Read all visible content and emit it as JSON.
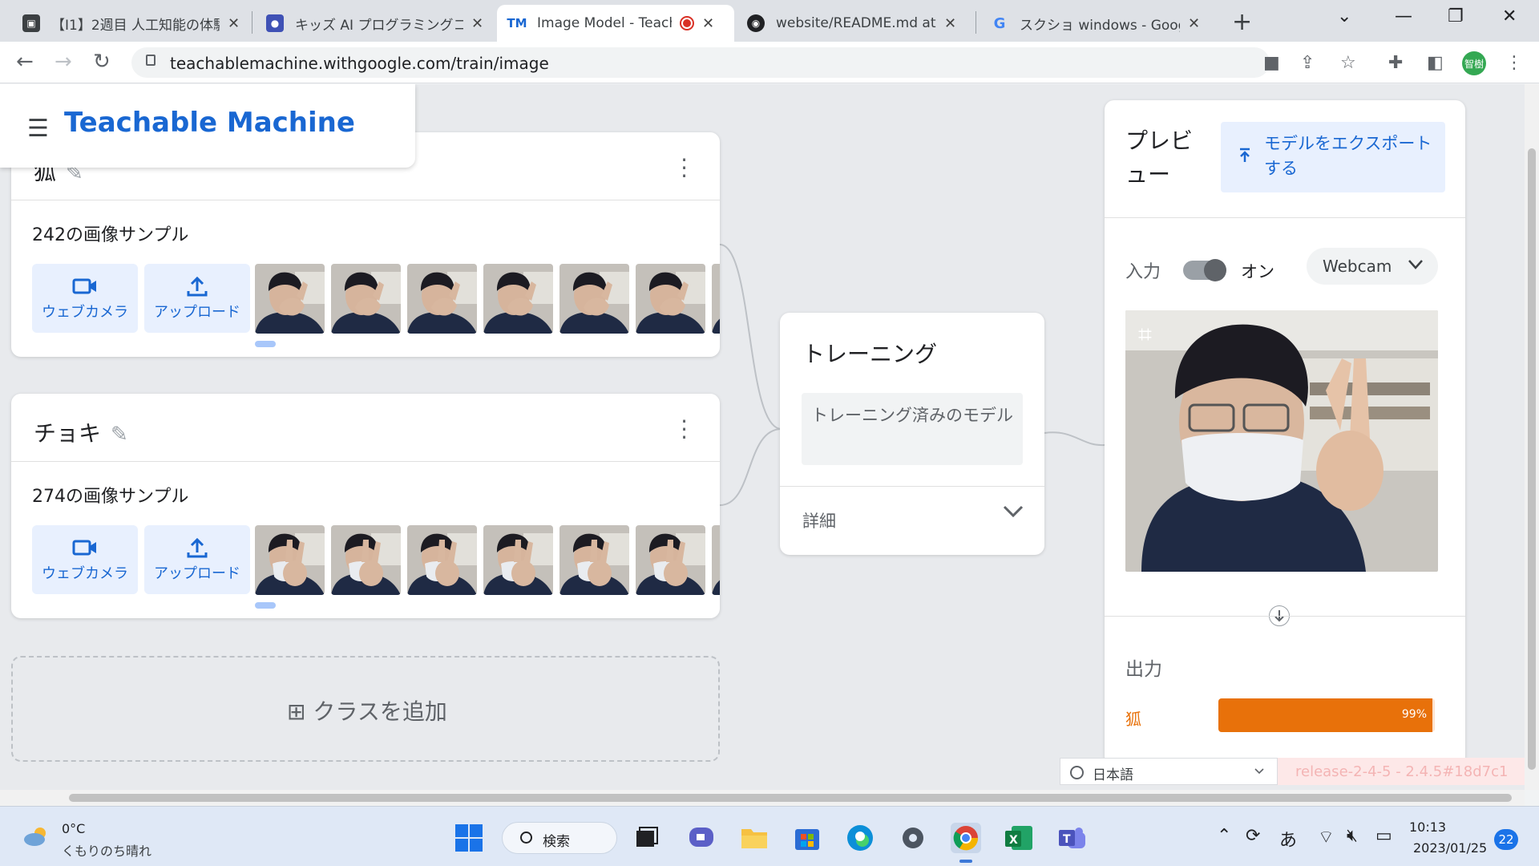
{
  "browser": {
    "tabs": [
      {
        "title": "【I1】2週目 人工知能の体験",
        "favicon": "classroom-icon",
        "active": false
      },
      {
        "title": "キッズ AI プログラミングコンテ",
        "favicon": "forms-icon",
        "active": false
      },
      {
        "title": "Image Model - Teach",
        "favicon": "teachable-machine-icon",
        "active": true,
        "recording": true
      },
      {
        "title": "website/README.md at m",
        "favicon": "github-icon",
        "active": false
      },
      {
        "title": "スクショ windows - Google",
        "favicon": "google-icon",
        "active": false
      }
    ],
    "url": "teachablemachine.withgoogle.com/train/image",
    "profile_initials": "智樹"
  },
  "app": {
    "title": "Teachable Machine"
  },
  "classes": [
    {
      "name": "狐",
      "sample_count_label": "242の画像サンプル",
      "webcam_label": "ウェブカメラ",
      "upload_label": "アップロード"
    },
    {
      "name": "チョキ",
      "sample_count_label": "274の画像サンプル",
      "webcam_label": "ウェブカメラ",
      "upload_label": "アップロード"
    }
  ],
  "add_class_label": "クラスを追加",
  "training": {
    "title": "トレーニング",
    "button_label": "トレーニング済みのモデル",
    "details_label": "詳細"
  },
  "preview": {
    "title": "プレビュー",
    "export_label": "モデルをエクスポートする",
    "input_label": "入力",
    "toggle_label": "オン",
    "toggle_on": true,
    "source_label": "Webcam",
    "output_label": "出力",
    "outputs": [
      {
        "class": "狐",
        "percent_label": "99%",
        "value": 0.99,
        "color": "#e8710a"
      }
    ]
  },
  "footer": {
    "language": "日本語",
    "release": "release-2-4-5 - 2.4.5#18d7c1"
  },
  "taskbar": {
    "temperature": "0°C",
    "weather": "くもりのち晴れ",
    "search_label": "検索",
    "ime": "あ",
    "time": "10:13",
    "date": "2023/01/25",
    "notifications": "22"
  },
  "colors": {
    "brand": "#1967d2",
    "output": "#e8710a"
  }
}
